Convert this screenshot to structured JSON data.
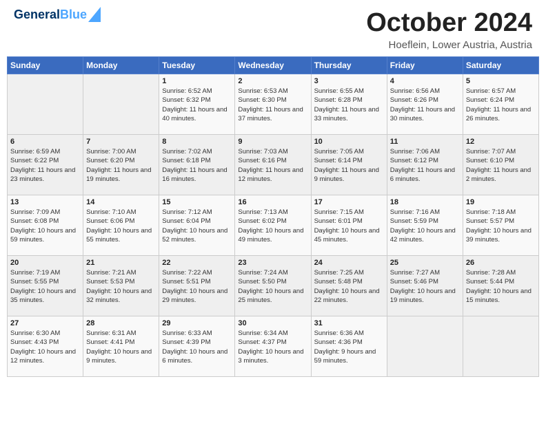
{
  "header": {
    "logo_line1": "General",
    "logo_line2": "Blue",
    "month": "October 2024",
    "location": "Hoeflein, Lower Austria, Austria"
  },
  "weekdays": [
    "Sunday",
    "Monday",
    "Tuesday",
    "Wednesday",
    "Thursday",
    "Friday",
    "Saturday"
  ],
  "weeks": [
    [
      {
        "num": "",
        "info": ""
      },
      {
        "num": "",
        "info": ""
      },
      {
        "num": "1",
        "info": "Sunrise: 6:52 AM\nSunset: 6:32 PM\nDaylight: 11 hours and 40 minutes."
      },
      {
        "num": "2",
        "info": "Sunrise: 6:53 AM\nSunset: 6:30 PM\nDaylight: 11 hours and 37 minutes."
      },
      {
        "num": "3",
        "info": "Sunrise: 6:55 AM\nSunset: 6:28 PM\nDaylight: 11 hours and 33 minutes."
      },
      {
        "num": "4",
        "info": "Sunrise: 6:56 AM\nSunset: 6:26 PM\nDaylight: 11 hours and 30 minutes."
      },
      {
        "num": "5",
        "info": "Sunrise: 6:57 AM\nSunset: 6:24 PM\nDaylight: 11 hours and 26 minutes."
      }
    ],
    [
      {
        "num": "6",
        "info": "Sunrise: 6:59 AM\nSunset: 6:22 PM\nDaylight: 11 hours and 23 minutes."
      },
      {
        "num": "7",
        "info": "Sunrise: 7:00 AM\nSunset: 6:20 PM\nDaylight: 11 hours and 19 minutes."
      },
      {
        "num": "8",
        "info": "Sunrise: 7:02 AM\nSunset: 6:18 PM\nDaylight: 11 hours and 16 minutes."
      },
      {
        "num": "9",
        "info": "Sunrise: 7:03 AM\nSunset: 6:16 PM\nDaylight: 11 hours and 12 minutes."
      },
      {
        "num": "10",
        "info": "Sunrise: 7:05 AM\nSunset: 6:14 PM\nDaylight: 11 hours and 9 minutes."
      },
      {
        "num": "11",
        "info": "Sunrise: 7:06 AM\nSunset: 6:12 PM\nDaylight: 11 hours and 6 minutes."
      },
      {
        "num": "12",
        "info": "Sunrise: 7:07 AM\nSunset: 6:10 PM\nDaylight: 11 hours and 2 minutes."
      }
    ],
    [
      {
        "num": "13",
        "info": "Sunrise: 7:09 AM\nSunset: 6:08 PM\nDaylight: 10 hours and 59 minutes."
      },
      {
        "num": "14",
        "info": "Sunrise: 7:10 AM\nSunset: 6:06 PM\nDaylight: 10 hours and 55 minutes."
      },
      {
        "num": "15",
        "info": "Sunrise: 7:12 AM\nSunset: 6:04 PM\nDaylight: 10 hours and 52 minutes."
      },
      {
        "num": "16",
        "info": "Sunrise: 7:13 AM\nSunset: 6:02 PM\nDaylight: 10 hours and 49 minutes."
      },
      {
        "num": "17",
        "info": "Sunrise: 7:15 AM\nSunset: 6:01 PM\nDaylight: 10 hours and 45 minutes."
      },
      {
        "num": "18",
        "info": "Sunrise: 7:16 AM\nSunset: 5:59 PM\nDaylight: 10 hours and 42 minutes."
      },
      {
        "num": "19",
        "info": "Sunrise: 7:18 AM\nSunset: 5:57 PM\nDaylight: 10 hours and 39 minutes."
      }
    ],
    [
      {
        "num": "20",
        "info": "Sunrise: 7:19 AM\nSunset: 5:55 PM\nDaylight: 10 hours and 35 minutes."
      },
      {
        "num": "21",
        "info": "Sunrise: 7:21 AM\nSunset: 5:53 PM\nDaylight: 10 hours and 32 minutes."
      },
      {
        "num": "22",
        "info": "Sunrise: 7:22 AM\nSunset: 5:51 PM\nDaylight: 10 hours and 29 minutes."
      },
      {
        "num": "23",
        "info": "Sunrise: 7:24 AM\nSunset: 5:50 PM\nDaylight: 10 hours and 25 minutes."
      },
      {
        "num": "24",
        "info": "Sunrise: 7:25 AM\nSunset: 5:48 PM\nDaylight: 10 hours and 22 minutes."
      },
      {
        "num": "25",
        "info": "Sunrise: 7:27 AM\nSunset: 5:46 PM\nDaylight: 10 hours and 19 minutes."
      },
      {
        "num": "26",
        "info": "Sunrise: 7:28 AM\nSunset: 5:44 PM\nDaylight: 10 hours and 15 minutes."
      }
    ],
    [
      {
        "num": "27",
        "info": "Sunrise: 6:30 AM\nSunset: 4:43 PM\nDaylight: 10 hours and 12 minutes."
      },
      {
        "num": "28",
        "info": "Sunrise: 6:31 AM\nSunset: 4:41 PM\nDaylight: 10 hours and 9 minutes."
      },
      {
        "num": "29",
        "info": "Sunrise: 6:33 AM\nSunset: 4:39 PM\nDaylight: 10 hours and 6 minutes."
      },
      {
        "num": "30",
        "info": "Sunrise: 6:34 AM\nSunset: 4:37 PM\nDaylight: 10 hours and 3 minutes."
      },
      {
        "num": "31",
        "info": "Sunrise: 6:36 AM\nSunset: 4:36 PM\nDaylight: 9 hours and 59 minutes."
      },
      {
        "num": "",
        "info": ""
      },
      {
        "num": "",
        "info": ""
      }
    ]
  ]
}
